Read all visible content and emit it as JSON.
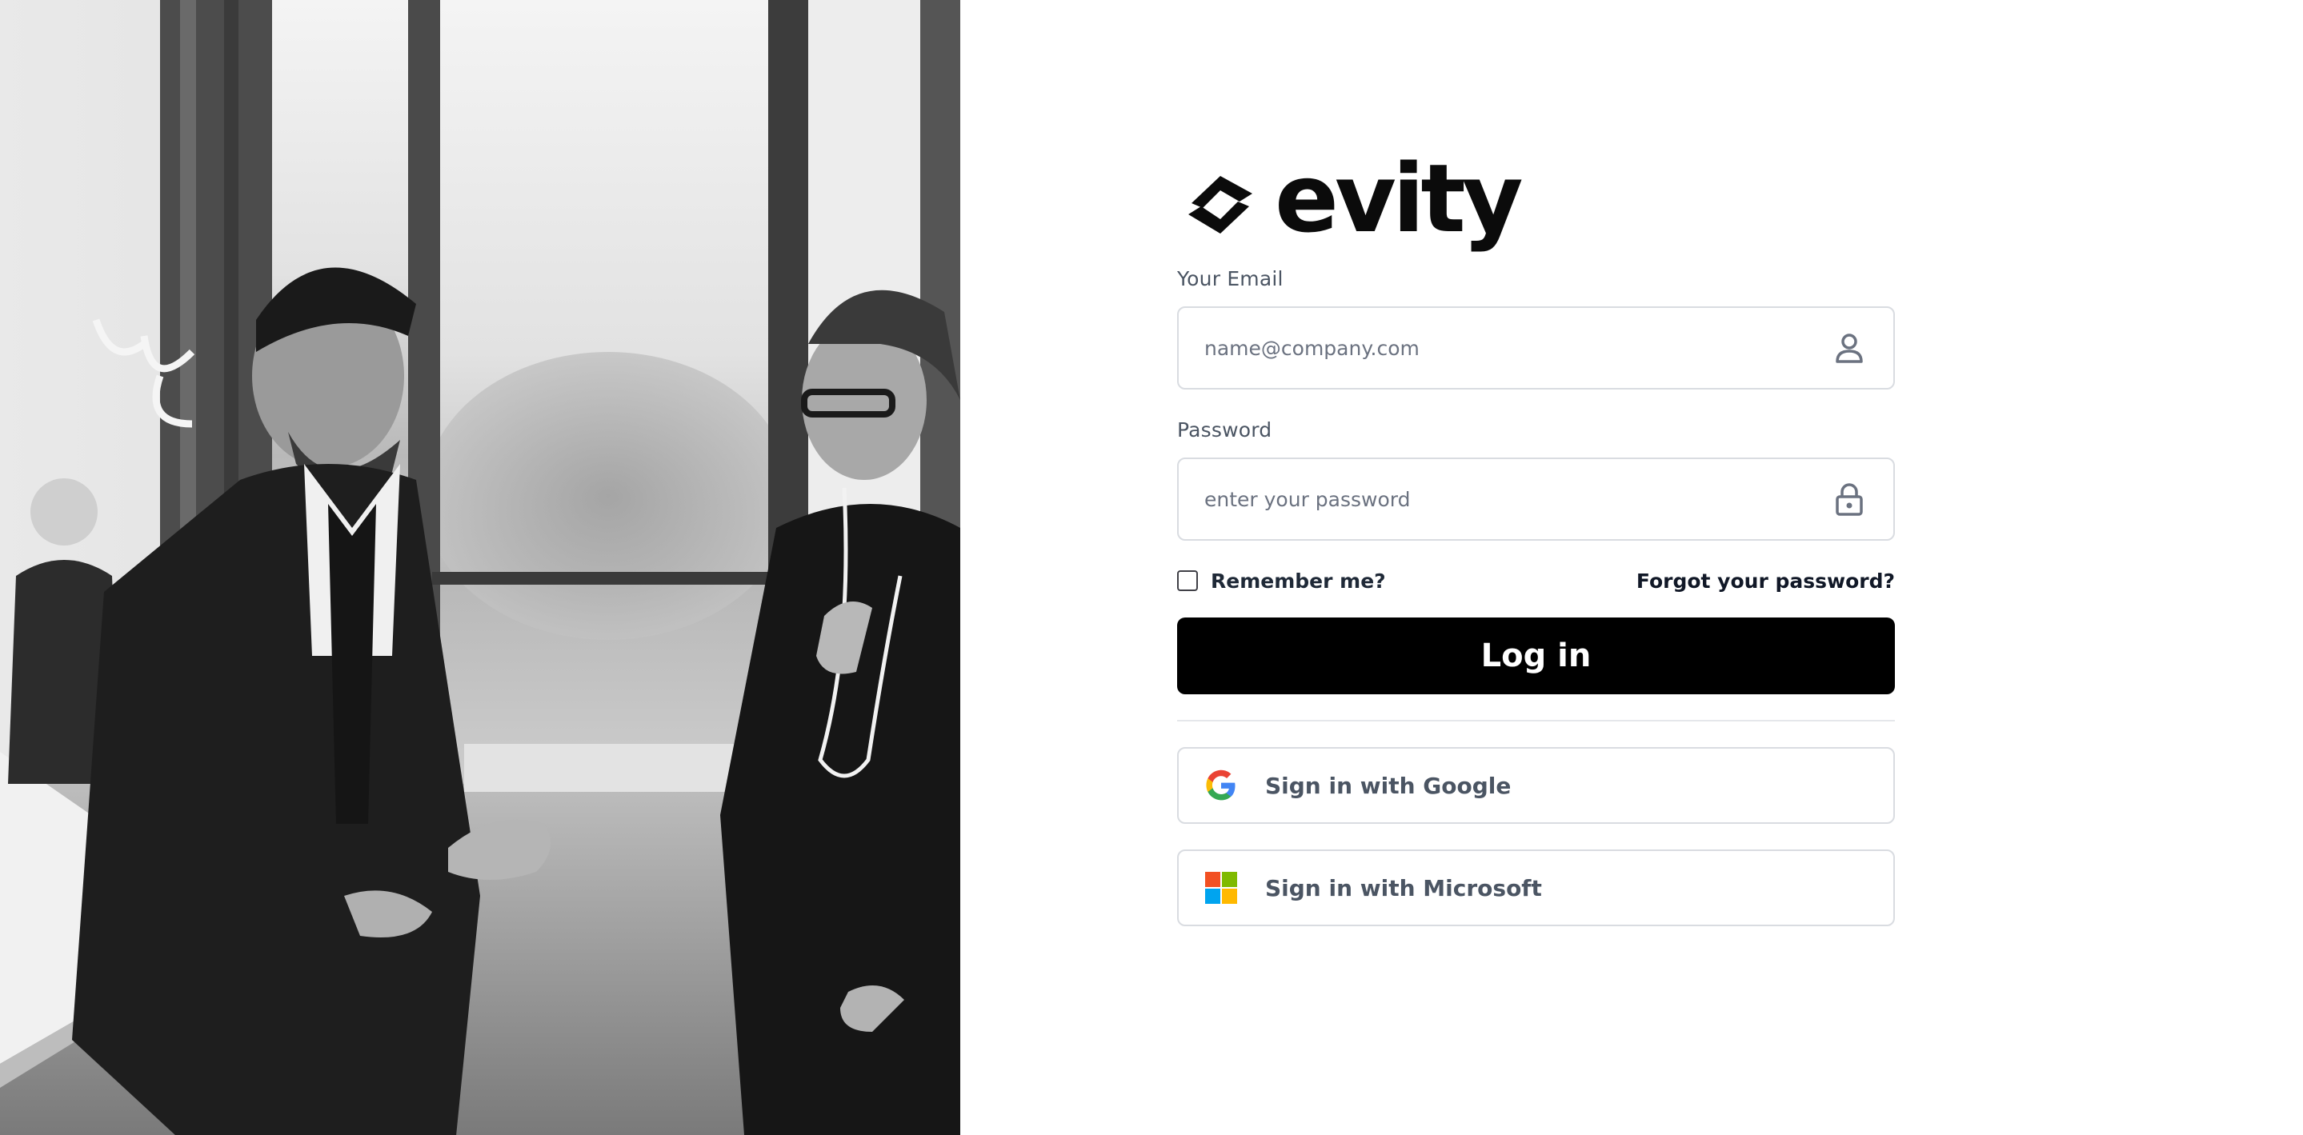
{
  "brand": {
    "name": "evity",
    "logo_icon": "evity-logo-mark",
    "color": "#0b0b0b"
  },
  "hero_image": {
    "icon": "office-meeting-photo",
    "style": "black-and-white"
  },
  "login_form": {
    "email": {
      "label": "Your Email",
      "placeholder": "name@company.com",
      "value": "",
      "icon": "user-icon"
    },
    "password": {
      "label": "Password",
      "placeholder": "enter your password",
      "value": "",
      "icon": "lock-icon"
    },
    "remember_me": {
      "label": "Remember me?",
      "checked": false
    },
    "forgot_password_label": "Forgot your password?",
    "submit_label": "Log in",
    "submit_color": "#000000"
  },
  "sso": {
    "google": {
      "label": "Sign in with Google",
      "icon": "google-icon"
    },
    "microsoft": {
      "label": "Sign in with Microsoft",
      "icon": "microsoft-icon"
    }
  },
  "colors": {
    "label_text": "#4b5563",
    "border": "#d9dce1",
    "background": "#ffffff"
  }
}
